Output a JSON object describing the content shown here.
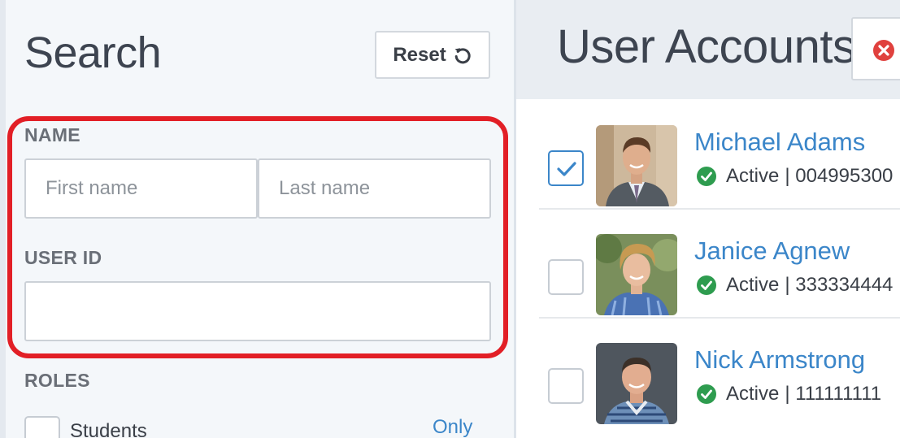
{
  "search_panel": {
    "title": "Search",
    "reset_label": "Reset",
    "name": {
      "label": "NAME",
      "first_placeholder": "First name",
      "last_placeholder": "Last name"
    },
    "user_id": {
      "label": "USER ID",
      "value": ""
    },
    "roles": {
      "label": "ROLES",
      "option_label": "Students",
      "only_link": "Only"
    }
  },
  "accounts_panel": {
    "title": "User Accounts",
    "users": [
      {
        "name": "Michael Adams",
        "status": "Active",
        "id_text": "| 004995300",
        "checked": true
      },
      {
        "name": "Janice Agnew",
        "status": "Active",
        "id_text": "| 333334444",
        "checked": false
      },
      {
        "name": "Nick Armstrong",
        "status": "Active",
        "id_text": "| 111111111",
        "checked": false
      }
    ]
  },
  "colors": {
    "accent": "#3b86c9",
    "highlight": "#e21f26",
    "active_status": "#2e9c4f",
    "close_icon": "#e0413e"
  }
}
